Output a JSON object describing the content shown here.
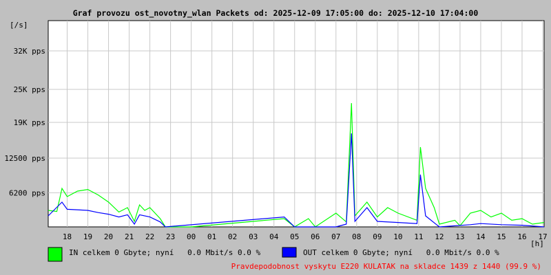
{
  "title": "Graf provozu ost_novotny_wlan Packets od: 2025-12-09 17:05:00 do: 2025-12-10 17:04:00",
  "unit_label": "[/s]",
  "x_unit_label": "[h]",
  "legend": {
    "in": {
      "text": "IN celkem 0 Gbyte; nyní   0.0 Mbit/s 0.0 %",
      "color": "#00ff00"
    },
    "out": {
      "text": "OUT celkem 0 Gbyte; nyní   0.0 Mbit/s 0.0 %",
      "color": "#0000ff"
    }
  },
  "footer_note": {
    "text": "Pravdepodobnost vyskytu E220 KULATAK na skladce 1439 z 1440 (99.9 %)",
    "color": "#ff0000"
  },
  "chart_data": {
    "type": "line",
    "x_range": [
      "2025-12-09 17:05:00",
      "2025-12-10 17:04:00"
    ],
    "x_ticks": [
      "18",
      "19",
      "20",
      "21",
      "22",
      "23",
      "00",
      "01",
      "02",
      "03",
      "04",
      "05",
      "06",
      "07",
      "08",
      "09",
      "10",
      "11",
      "12",
      "13",
      "14",
      "15",
      "16",
      "17"
    ],
    "y_ticks": [
      {
        "value": 6200,
        "label": "6200 pps"
      },
      {
        "value": 12500,
        "label": "12500 pps"
      },
      {
        "value": 19000,
        "label": "19K pps"
      },
      {
        "value": 25000,
        "label": "25K pps"
      },
      {
        "value": 32000,
        "label": "32K pps"
      }
    ],
    "ylim": [
      0,
      37500
    ],
    "grid": true,
    "series": [
      {
        "name": "IN",
        "color": "#00ff00",
        "points": [
          [
            "2025-12-09 17:05",
            3000
          ],
          [
            "2025-12-09 17:30",
            2800
          ],
          [
            "2025-12-09 17:45",
            7000
          ],
          [
            "2025-12-09 18:00",
            5500
          ],
          [
            "2025-12-09 18:30",
            6500
          ],
          [
            "2025-12-09 19:00",
            6800
          ],
          [
            "2025-12-09 19:30",
            5800
          ],
          [
            "2025-12-09 20:00",
            4500
          ],
          [
            "2025-12-09 20:30",
            2700
          ],
          [
            "2025-12-09 20:55",
            3500
          ],
          [
            "2025-12-09 21:15",
            1000
          ],
          [
            "2025-12-09 21:30",
            4000
          ],
          [
            "2025-12-09 21:45",
            3000
          ],
          [
            "2025-12-09 22:00",
            3500
          ],
          [
            "2025-12-09 22:30",
            1500
          ],
          [
            "2025-12-09 22:45",
            0
          ],
          [
            "2025-12-10 00:00",
            0
          ],
          [
            "2025-12-10 04:30",
            1500
          ],
          [
            "2025-12-10 05:00",
            0
          ],
          [
            "2025-12-10 05:40",
            1500
          ],
          [
            "2025-12-10 06:00",
            0
          ],
          [
            "2025-12-10 07:00",
            2500
          ],
          [
            "2025-12-10 07:30",
            900
          ],
          [
            "2025-12-10 07:45",
            22500
          ],
          [
            "2025-12-10 07:55",
            2000
          ],
          [
            "2025-12-10 08:30",
            4500
          ],
          [
            "2025-12-10 09:00",
            1800
          ],
          [
            "2025-12-10 09:30",
            3500
          ],
          [
            "2025-12-10 10:00",
            2500
          ],
          [
            "2025-12-10 10:55",
            1200
          ],
          [
            "2025-12-10 11:05",
            14500
          ],
          [
            "2025-12-10 11:20",
            7000
          ],
          [
            "2025-12-10 11:45",
            3500
          ],
          [
            "2025-12-10 12:00",
            500
          ],
          [
            "2025-12-10 12:45",
            1200
          ],
          [
            "2025-12-10 13:00",
            200
          ],
          [
            "2025-12-10 13:30",
            2500
          ],
          [
            "2025-12-10 14:00",
            3000
          ],
          [
            "2025-12-10 14:30",
            1800
          ],
          [
            "2025-12-10 15:00",
            2500
          ],
          [
            "2025-12-10 15:30",
            1200
          ],
          [
            "2025-12-10 16:00",
            1500
          ],
          [
            "2025-12-10 16:30",
            500
          ],
          [
            "2025-12-10 17:04",
            800
          ]
        ]
      },
      {
        "name": "OUT",
        "color": "#0000ff",
        "points": [
          [
            "2025-12-09 17:05",
            2000
          ],
          [
            "2025-12-09 17:45",
            4500
          ],
          [
            "2025-12-09 18:00",
            3200
          ],
          [
            "2025-12-09 19:00",
            3000
          ],
          [
            "2025-12-09 19:30",
            2600
          ],
          [
            "2025-12-09 20:00",
            2300
          ],
          [
            "2025-12-09 20:30",
            1800
          ],
          [
            "2025-12-09 20:55",
            2200
          ],
          [
            "2025-12-09 21:15",
            500
          ],
          [
            "2025-12-09 21:30",
            2200
          ],
          [
            "2025-12-09 22:00",
            1800
          ],
          [
            "2025-12-09 22:30",
            900
          ],
          [
            "2025-12-09 22:45",
            0
          ],
          [
            "2025-12-10 04:30",
            1800
          ],
          [
            "2025-12-10 05:00",
            0
          ],
          [
            "2025-12-10 07:00",
            0
          ],
          [
            "2025-12-10 07:30",
            500
          ],
          [
            "2025-12-10 07:45",
            17000
          ],
          [
            "2025-12-10 07:55",
            1000
          ],
          [
            "2025-12-10 08:30",
            3500
          ],
          [
            "2025-12-10 09:00",
            1000
          ],
          [
            "2025-12-10 10:00",
            800
          ],
          [
            "2025-12-10 10:55",
            600
          ],
          [
            "2025-12-10 11:05",
            9500
          ],
          [
            "2025-12-10 11:20",
            2000
          ],
          [
            "2025-12-10 12:00",
            0
          ],
          [
            "2025-12-10 13:30",
            400
          ],
          [
            "2025-12-10 14:00",
            600
          ],
          [
            "2025-12-10 15:00",
            400
          ],
          [
            "2025-12-10 16:00",
            300
          ],
          [
            "2025-12-10 17:04",
            0
          ]
        ]
      }
    ]
  }
}
